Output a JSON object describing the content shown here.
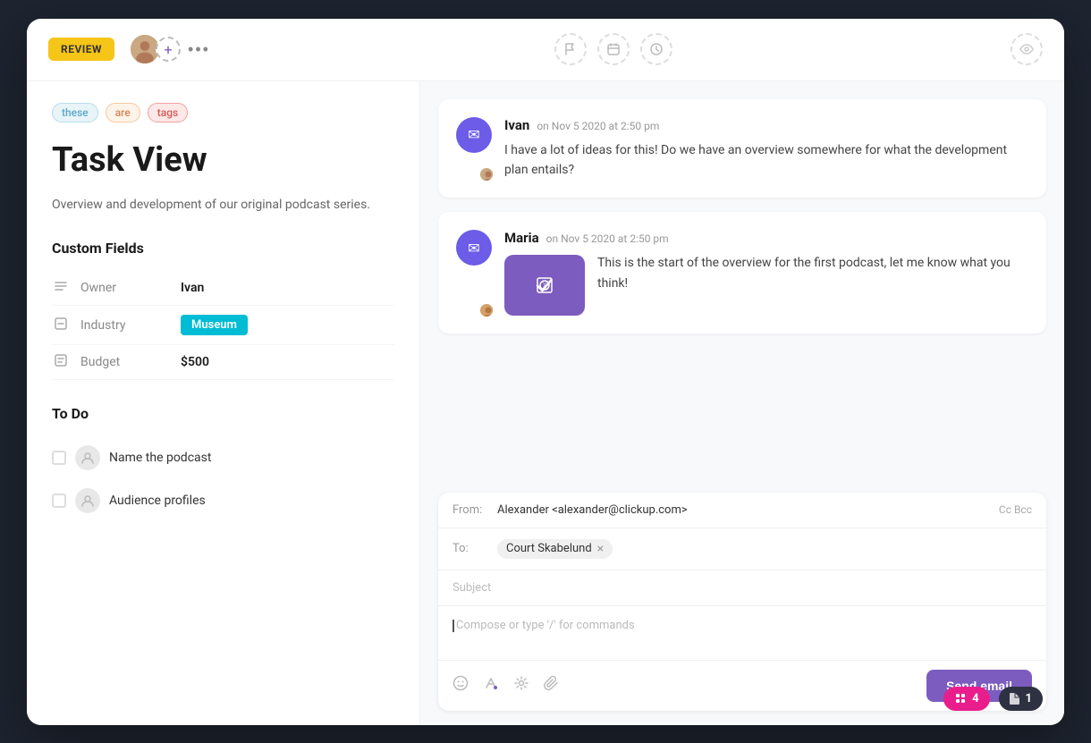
{
  "window": {
    "title": "Task View"
  },
  "topbar": {
    "review_label": "REVIEW",
    "more_label": "•••",
    "icons": {
      "flag": "⚑",
      "calendar": "📅",
      "clock": "🕐",
      "eye": "👁"
    }
  },
  "left": {
    "tags": [
      {
        "id": "these",
        "label": "these",
        "class": "tag-these"
      },
      {
        "id": "are",
        "label": "are",
        "class": "tag-are"
      },
      {
        "id": "tags",
        "label": "tags",
        "class": "tag-tags"
      }
    ],
    "title": "Task View",
    "description": "Overview and development of our original podcast series.",
    "custom_fields_title": "Custom Fields",
    "fields": [
      {
        "icon": "≡",
        "label": "Owner",
        "value": "Ivan",
        "type": "text"
      },
      {
        "icon": "□",
        "label": "Industry",
        "value": "Museum",
        "type": "badge"
      },
      {
        "icon": "□",
        "label": "Budget",
        "value": "$500",
        "type": "text"
      }
    ],
    "todo_title": "To Do",
    "todos": [
      {
        "label": "Name the podcast",
        "checked": false
      },
      {
        "label": "Audience profiles",
        "checked": false
      }
    ]
  },
  "bottom_badges": [
    {
      "icon": "🔖",
      "count": "4",
      "class": "badge-pink"
    },
    {
      "icon": "✏",
      "count": "1",
      "class": "badge-dark"
    }
  ],
  "comments": [
    {
      "author": "Ivan",
      "timestamp": "on Nov 5 2020 at 2:50 pm",
      "text": "I have a lot of ideas for this! Do we have an overview somewhere for what the development plan entails?",
      "has_attachment": false
    },
    {
      "author": "Maria",
      "timestamp": "on Nov 5 2020 at 2:50 pm",
      "text": "This is the start of the overview for the first podcast, let me know what you think!",
      "has_attachment": true,
      "attachment_icon": "📎"
    }
  ],
  "email": {
    "from_label": "From:",
    "from_value": "Alexander <alexander@clickup.com>",
    "cc_bcc": "Cc  Bcc",
    "to_label": "To:",
    "to_recipient": "Court Skabelund",
    "subject_placeholder": "Subject",
    "compose_placeholder": "Compose or type '/' for commands",
    "send_label": "Send email"
  }
}
